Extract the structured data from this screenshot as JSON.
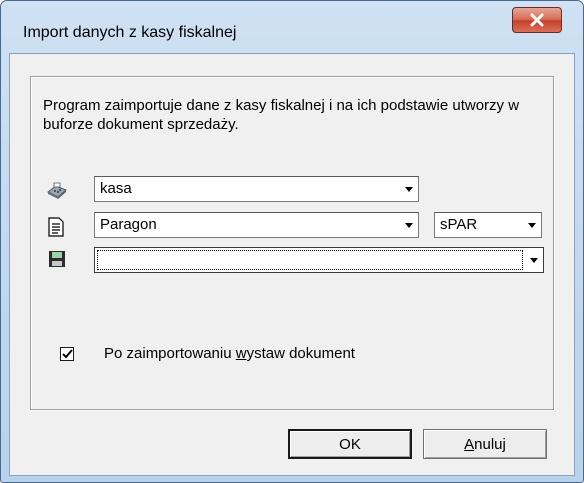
{
  "window": {
    "title": "Import danych z kasy fiskalnej",
    "close_label": "X"
  },
  "description": "Program zaimportuje dane z kasy fiskalnej i na ich podstawie utworzy w buforze dokument sprzedaży.",
  "fields": {
    "device": {
      "value": "kasa",
      "icon": "cash-register-icon"
    },
    "document_type": {
      "value": "Paragon",
      "icon": "document-icon"
    },
    "series": {
      "value": "sPAR"
    },
    "register": {
      "value": "",
      "icon": "floppy-disk-icon"
    }
  },
  "checkbox": {
    "label_pre": "Po zaimportowaniu ",
    "label_accel": "w",
    "label_post": "ystaw dokument",
    "checked": true
  },
  "buttons": {
    "ok_label": "OK",
    "cancel_accel": "A",
    "cancel_rest": "nuluj"
  }
}
